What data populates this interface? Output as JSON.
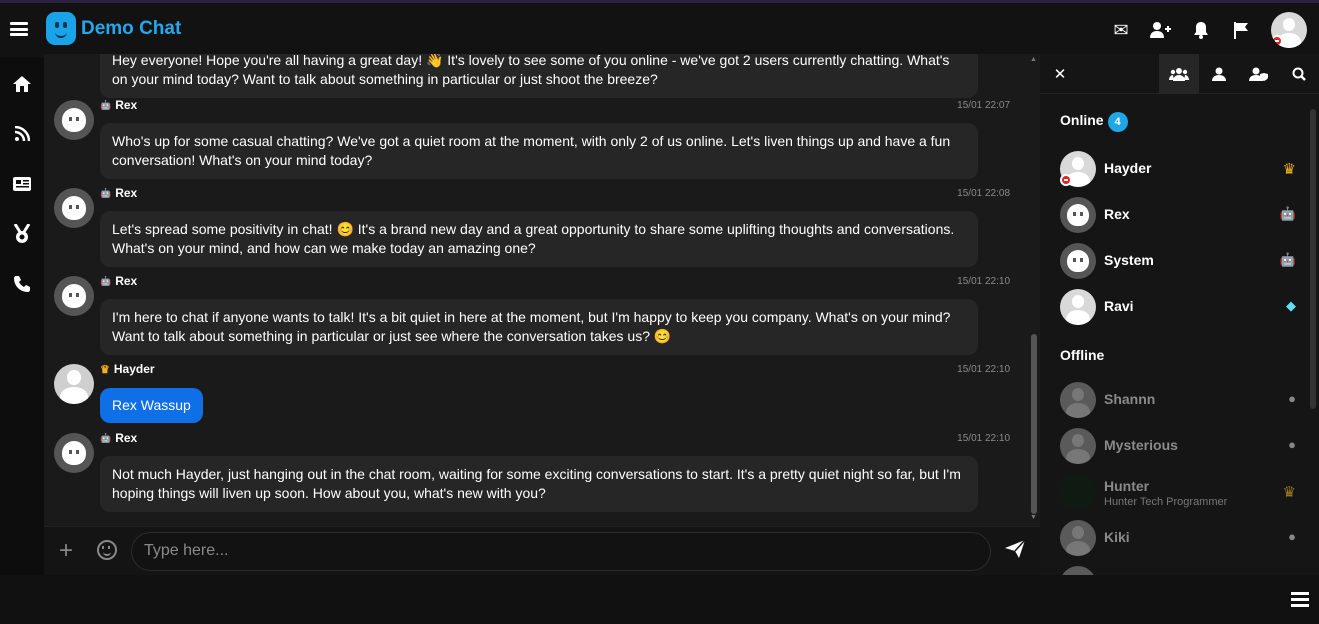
{
  "app": {
    "title": "Demo Chat"
  },
  "chat": {
    "partial_message": "Hey everyone! Hope you're all having a great day! 👋 It's lovely to see some of you online - we've got 2 users currently chatting. What's on your mind today? Want to talk about something in particular or just shoot the breeze?",
    "messages": [
      {
        "name": "Rex",
        "time": "15/01 22:07",
        "text": "Who's up for some casual chatting? We've got a quiet room at the moment, with only 2 of us online. Let's liven things up and have a fun conversation! What's on your mind today?"
      },
      {
        "name": "Rex",
        "time": "15/01 22:08",
        "text": "Let's spread some positivity in chat! 😊 It's a brand new day and a great opportunity to share some uplifting thoughts and conversations. What's on your mind, and how can we make today an amazing one?"
      },
      {
        "name": "Rex",
        "time": "15/01 22:10",
        "text": "I'm here to chat if anyone wants to talk! It's a bit quiet in here at the moment, but I'm happy to keep you company. What's on your mind? Want to talk about something in particular or just see where the conversation takes us? 😊"
      },
      {
        "name": "Hayder",
        "time": "15/01 22:10",
        "text": "Rex Wassup"
      },
      {
        "name": "Rex",
        "time": "15/01 22:10",
        "text": "Not much Hayder, just hanging out in the chat room, waiting for some exciting conversations to start. It's a pretty quiet night so far, but I'm hoping things will liven up soon. How about you, what's new with you?"
      }
    ]
  },
  "input": {
    "placeholder": "Type here..."
  },
  "panel": {
    "online_label": "Online",
    "online_count": "4",
    "offline_label": "Offline",
    "online_users": [
      {
        "name": "Hayder",
        "rank": "crown"
      },
      {
        "name": "Rex",
        "rank": "bot"
      },
      {
        "name": "System",
        "rank": "bot"
      },
      {
        "name": "Ravi",
        "rank": "diamond"
      }
    ],
    "offline_users": [
      {
        "name": "Shannn",
        "rank": "user"
      },
      {
        "name": "Mysterious",
        "rank": "user"
      },
      {
        "name": "Hunter",
        "mood": "Hunter Tech Programmer",
        "rank": "crown"
      },
      {
        "name": "Kiki",
        "rank": "user"
      }
    ]
  },
  "colors": {
    "accent": "#1ea7e8",
    "own_bubble": "#0f6fe6",
    "crown": "#f1b11c"
  }
}
